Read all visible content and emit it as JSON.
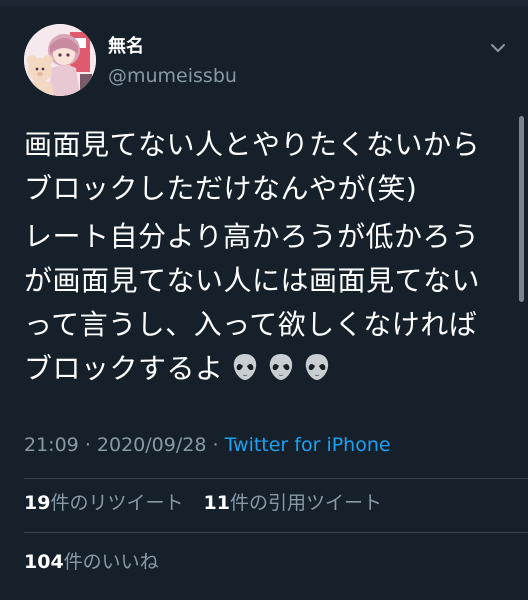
{
  "user": {
    "display_name": "無名",
    "handle": "@mumeissbu",
    "avatar_icon": "anime-avatar-icon"
  },
  "tweet": {
    "paragraphs": [
      [
        "画面見てない人とやりたくないから",
        "ブロックしただけなんやが(笑)"
      ],
      [
        "レート自分より高かろうが低かろう",
        "が画面見てない人には画面見てない",
        "って言うし、入って欲しくなければ",
        "ブロックするよ"
      ]
    ],
    "emoji": [
      "alien-emoji",
      "alien-emoji",
      "alien-emoji"
    ]
  },
  "meta": {
    "time": "21:09",
    "date": "2020/09/28",
    "separator": "·",
    "source": "Twitter for iPhone"
  },
  "stats": {
    "retweets": {
      "count": "19",
      "label": "件のリツイート"
    },
    "quotes": {
      "count": "11",
      "label": "件の引用ツイート"
    },
    "likes": {
      "count": "104",
      "label": "件のいいね"
    }
  },
  "colors": {
    "background": "#15202b",
    "text": "#ffffff",
    "secondary": "#8899a6",
    "accent": "#1da1f2",
    "divider": "#38444d"
  }
}
